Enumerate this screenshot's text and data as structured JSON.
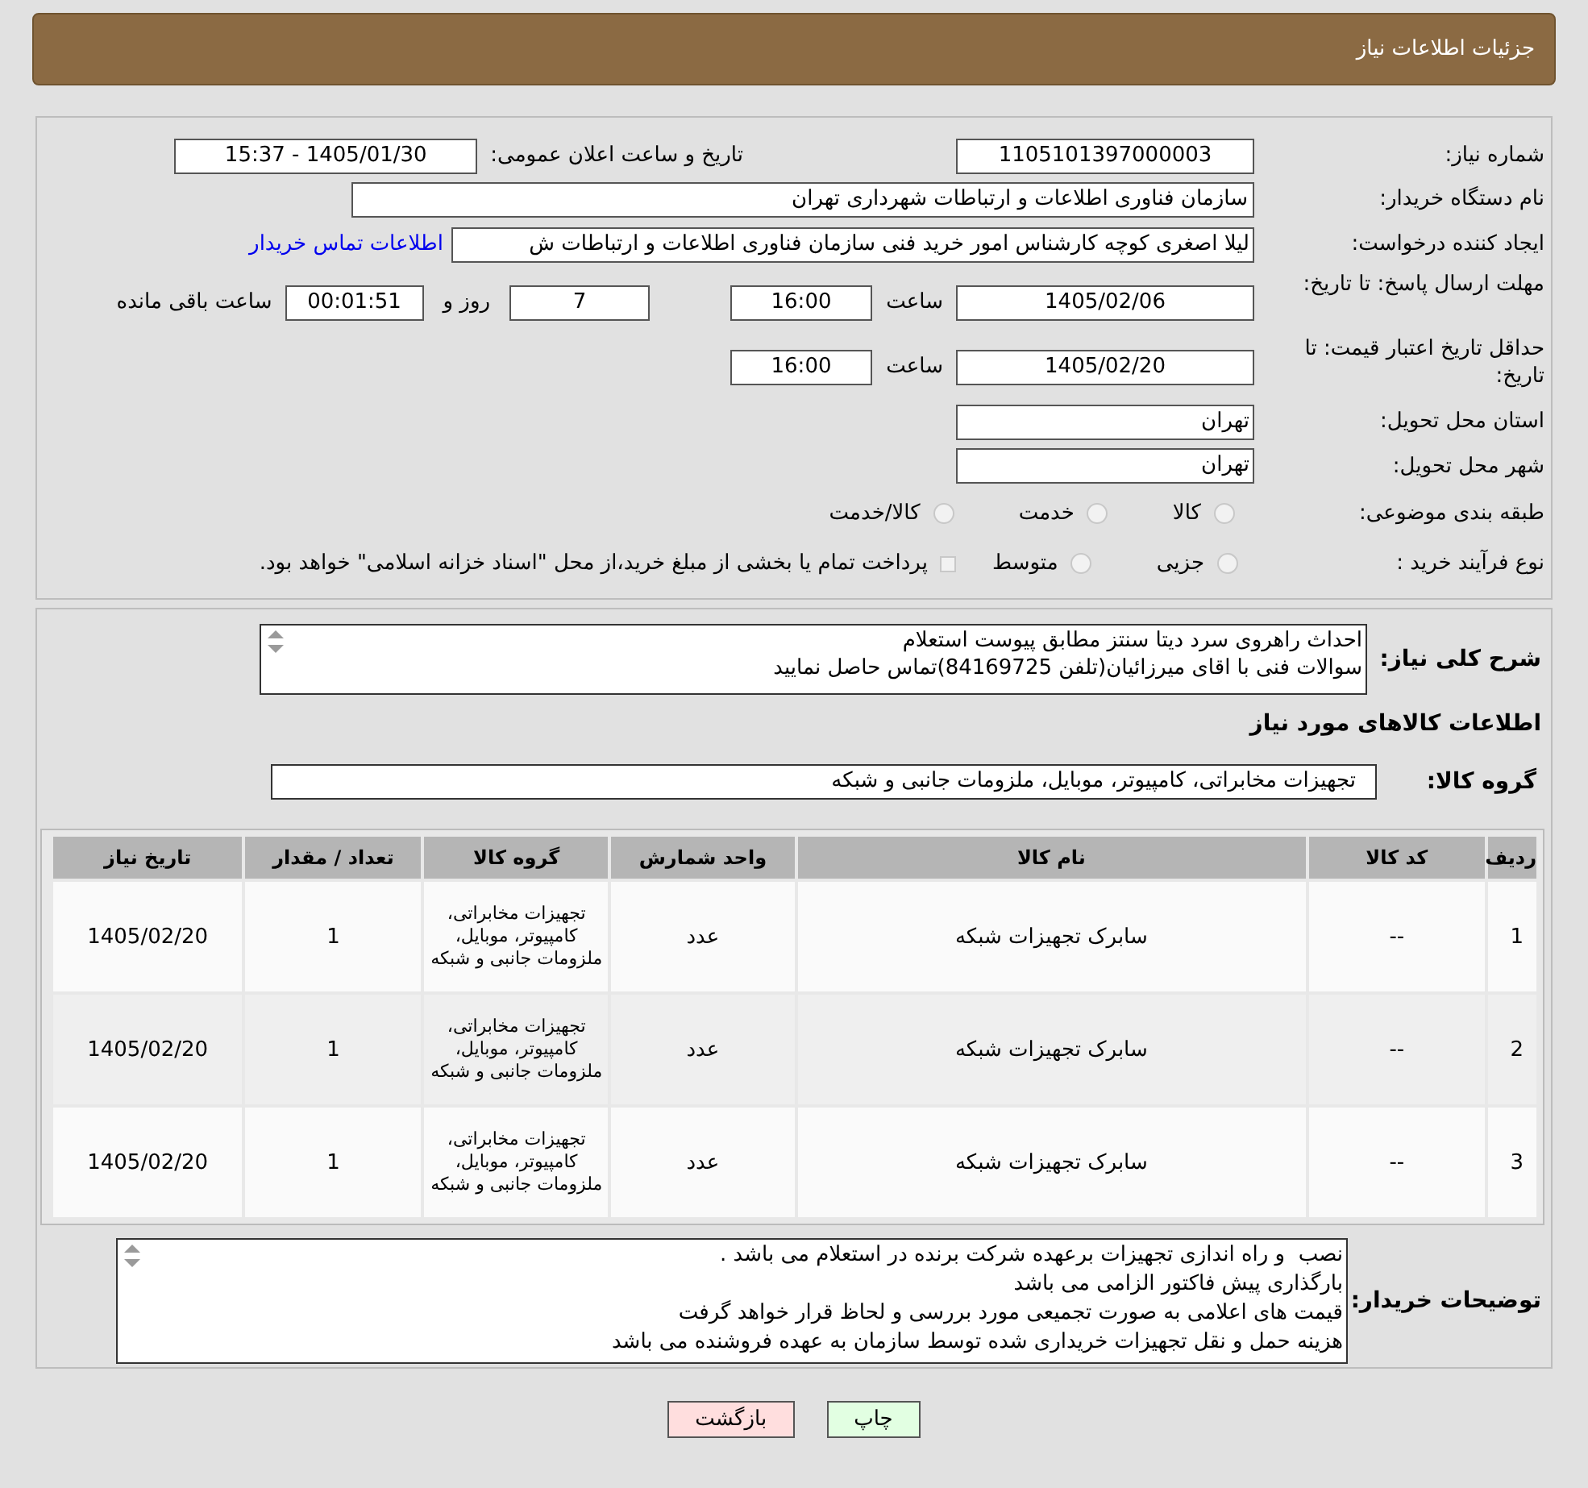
{
  "header": {
    "title": "جزئیات اطلاعات نیاز"
  },
  "details": {
    "need_number": {
      "label": "شماره نیاز:",
      "value": "1105101397000003"
    },
    "announce": {
      "label": "تاریخ و ساعت اعلان عمومی:",
      "value": "1405/01/30 - 15:37"
    },
    "buyer": {
      "label": "نام دستگاه خریدار:",
      "value": "سازمان فناوری اطلاعات و ارتباطات شهرداری تهران"
    },
    "requester": {
      "label": "ایجاد کننده درخواست:",
      "value": "لیلا اصغری کوچه کارشناس امور خرید فنی سازمان فناوری اطلاعات و ارتباطات ش",
      "link": "اطلاعات تماس خریدار"
    },
    "deadline": {
      "label": "مهلت ارسال پاسخ: تا تاریخ:",
      "date": "1405/02/06",
      "time_label": "ساعت",
      "time": "16:00",
      "days": "7",
      "days_label": "روز و",
      "remaining": "00:01:51",
      "remaining_label": "ساعت باقی مانده"
    },
    "validity": {
      "label": "حداقل تاریخ اعتبار قیمت: تا تاریخ:",
      "date": "1405/02/20",
      "time_label": "ساعت",
      "time": "16:00"
    },
    "province": {
      "label": "استان محل تحویل:",
      "value": "تهران"
    },
    "city": {
      "label": "شهر محل تحویل:",
      "value": "تهران"
    },
    "category": {
      "label": "طبقه بندی موضوعی:",
      "options": [
        {
          "kind": "radio",
          "label": "کالا",
          "selected": false
        },
        {
          "kind": "radio",
          "label": "خدمت",
          "selected": false
        },
        {
          "kind": "radio",
          "label": "کالا/خدمت",
          "selected": false
        }
      ]
    },
    "process": {
      "label": "نوع فرآیند خرید :",
      "options": [
        {
          "kind": "radio",
          "label": "جزیی",
          "selected": false
        },
        {
          "kind": "radio",
          "label": "متوسط",
          "selected": false
        },
        {
          "kind": "checkbox",
          "label": "پرداخت تمام یا بخشی از مبلغ خرید،از محل \"اسناد خزانه اسلامی\" خواهد بود.",
          "checked": false
        }
      ]
    }
  },
  "items": {
    "description": {
      "label": "شرح کلی نیاز:",
      "lines": [
        "احداث راهروی سرد دیتا سنتز مطابق پیوست استعلام",
        "سوالات فنی با اقای میرزائیان(تلفن 84169725)تماس حاصل نمایید"
      ]
    },
    "heading": "اطلاعات کالاهای مورد نیاز",
    "group": {
      "label": "گروه کالا:",
      "value": "تجهیزات مخابراتی، کامپیوتر، موبایل، ملزومات جانبی و شبکه"
    },
    "table": {
      "columns": [
        "ردیف",
        "کد کالا",
        "نام کالا",
        "واحد شمارش",
        "گروه کالا",
        "تعداد / مقدار",
        "تاریخ نیاز"
      ],
      "rows": [
        [
          "1",
          "--",
          "سابرک تجهیزات شبکه",
          "عدد",
          "تجهیزات مخابراتی، کامپیوتر، موبایل، ملزومات جانبی و شبکه",
          "1",
          "1405/02/20"
        ],
        [
          "2",
          "--",
          "سابرک تجهیزات شبکه",
          "عدد",
          "تجهیزات مخابراتی، کامپیوتر، موبایل، ملزومات جانبی و شبکه",
          "1",
          "1405/02/20"
        ],
        [
          "3",
          "--",
          "سابرک تجهیزات شبکه",
          "عدد",
          "تجهیزات مخابراتی، کامپیوتر، موبایل، ملزومات جانبی و شبکه",
          "1",
          "1405/02/20"
        ]
      ]
    },
    "notes": {
      "label": "توضیحات خریدار:",
      "lines": [
        "نصب  و راه اندازی تجهیزات برعهده شرکت برنده در استعلام می باشد .",
        "بارگذاری پیش فاکتور الزامی می باشد",
        "قیمت های اعلامی به صورت تجمیعی مورد بررسی و لحاظ قرار خواهد گرفت",
        "هزینه حمل و نقل تجهیزات خریداری شده توسط سازمان به عهده فروشنده می باشد"
      ]
    }
  },
  "buttons": [
    {
      "kind": "print",
      "label": "چاپ"
    },
    {
      "kind": "back",
      "label": "بازگشت"
    }
  ]
}
